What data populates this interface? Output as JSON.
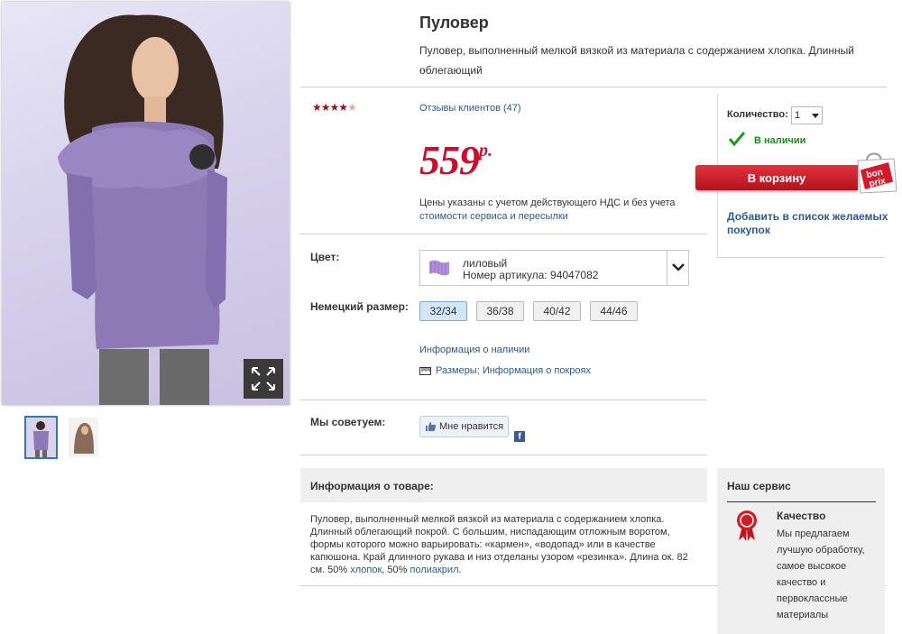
{
  "product": {
    "title": "Пуловер",
    "short_description": "Пуловер, выполненный мелкой вязкой из материала с содержанием хлопка. Длинный облегающий",
    "ellipsis": "...",
    "rating": {
      "stars_filled": 4,
      "stars_total": 5
    },
    "reviews_link": "Отзывы клиентов (47)",
    "price": {
      "amount": "559",
      "currency": "р."
    },
    "vat_note": "Цены указаны с учетом действующего НДС и без учета",
    "vat_link": "стоимости сервиса и пересылки"
  },
  "options": {
    "color_label": "Цвет:",
    "color_name": "лиловый",
    "article_number": "Номер артикула: 94047082",
    "color_swatch": "#b48ed9",
    "size_label": "Немецкий размер:",
    "sizes": [
      "32/34",
      "36/38",
      "40/42",
      "44/46"
    ],
    "selected_size": "32/34",
    "availability_link": "Информация о наличии",
    "size_info_link": "Размеры; Информация о покроях"
  },
  "social": {
    "label": "Мы советуем:",
    "like_button": "Мне нравится",
    "fb_icon": "f"
  },
  "cart": {
    "quantity_label": "Количество:",
    "quantity_value": "1",
    "in_stock": "В наличии",
    "add_to_cart": "В корзину",
    "wishlist_link": "Добавить в список желаемых покупок",
    "bag_brand": "bon prix"
  },
  "info": {
    "heading": "Информация о товаре:",
    "text_before": "Пуловер, выполненный мелкой вязкой из материала с содержанием хлопка. Длинный облегающий покрой. С большим, ниспадающим отложным воротом, формы которого можно варьировать: «кармен», «водопад» или в качестве капюшона. Край длинного рукава и низ отделаны узором «резинка». Длина ок. 82 см. 50% ",
    "link_cotton": "хлопок",
    "text_middle": ", 50% ",
    "link_polyacryl": "полиакрил",
    "text_after": "."
  },
  "service": {
    "title": "Наш сервис",
    "subtitle": "Качество",
    "text": "Мы предлагаем лучшую обработку, самое высокое качество и первоклассные материалы"
  },
  "colors": {
    "price_red": "#c8102e",
    "link_blue": "#2b5b8f",
    "instock_green": "#1f8a1f"
  }
}
